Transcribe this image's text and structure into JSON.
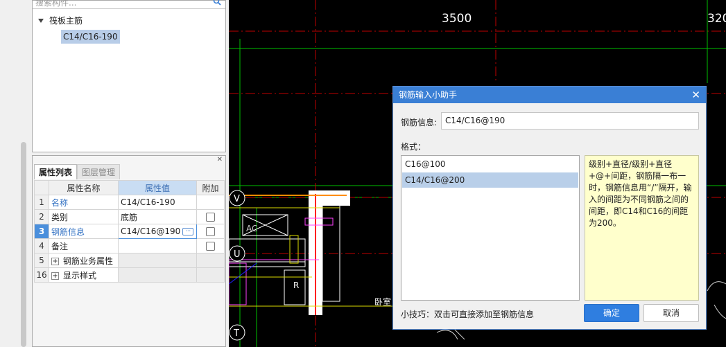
{
  "tree": {
    "search_placeholder": "搜索构件...",
    "root_label": "筏板主筋",
    "child_label": "C14/C16-190"
  },
  "props": {
    "tabs": [
      "属性列表",
      "图层管理"
    ],
    "headers": {
      "name": "属性名称",
      "value": "属性值",
      "extra": "附加"
    },
    "rows": [
      {
        "num": "1",
        "name": "名称",
        "value": "C14/C16-190"
      },
      {
        "num": "2",
        "name": "类别",
        "value": "底筋"
      },
      {
        "num": "3",
        "name": "钢筋信息",
        "value": "C14/C16@190"
      },
      {
        "num": "4",
        "name": "备注",
        "value": ""
      },
      {
        "num": "5",
        "name": "钢筋业务属性",
        "value": ""
      },
      {
        "num": "16",
        "name": "显示样式",
        "value": ""
      }
    ]
  },
  "cad": {
    "dims": [
      "3500",
      "320"
    ],
    "markers": [
      "V",
      "U",
      "T"
    ],
    "labels": [
      "AC",
      "R",
      "卧室"
    ]
  },
  "dialog": {
    "title": "钢筋输入小助手",
    "info_label": "钢筋信息:",
    "info_value": "C14/C16@190",
    "format_label": "格式：",
    "formats": [
      "C16@100",
      "C14/C16@200"
    ],
    "help_text": "级别+直径/级别+直径+@+间距，钢筋隔一布一时，钢筋信息用“/”隔开，输入的间距为不同钢筋之间的间距，即C14和C16的间距为200。",
    "tip": "小技巧：双击可直接添加至钢筋信息",
    "ok": "确定",
    "cancel": "取消"
  },
  "colors": {
    "accent": "#3a7fd5",
    "selected_row": "#b9cfe9",
    "help_bg": "#ffffcc"
  }
}
